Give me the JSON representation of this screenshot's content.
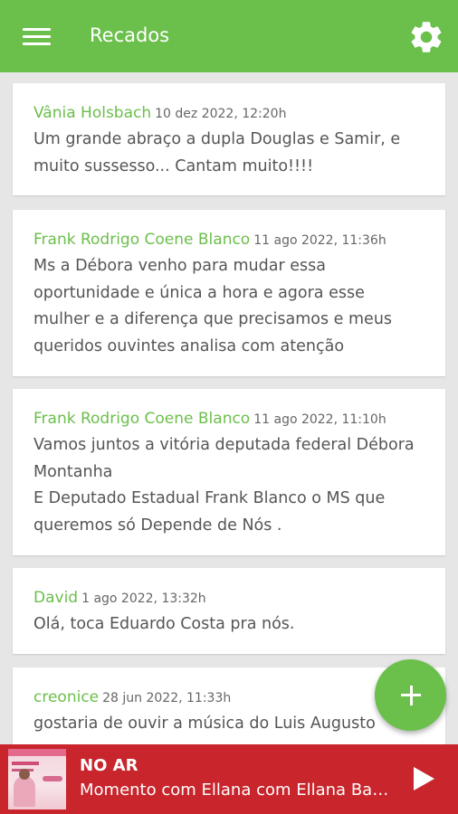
{
  "appbar": {
    "title": "Recados",
    "menu_icon": "hamburger-menu-icon",
    "settings_icon": "gear-icon",
    "color": "#6bbf4b"
  },
  "messages": [
    {
      "author": "Vânia Holsbach",
      "date": "10 dez 2022, 12:20h",
      "text": "Um grande abraço a dupla Douglas e Samir, e muito sussesso... Cantam muito!!!!"
    },
    {
      "author": "Frank Rodrigo Coene Blanco",
      "date": "11 ago 2022, 11:36h",
      "text": "Ms a Débora venho para mudar essa oportunidade e única a hora e agora esse mulher e a diferença que precisamos e meus queridos ouvintes analisa com atenção"
    },
    {
      "author": "Frank Rodrigo Coene Blanco",
      "date": "11 ago 2022, 11:10h",
      "text": "Vamos juntos a vitória deputada federal Débora Montanha\nE Deputado Estadual Frank Blanco o MS que queremos só Depende de Nós ."
    },
    {
      "author": "David",
      "date": "1 ago 2022, 13:32h",
      "text": "Olá, toca Eduardo Costa pra nós."
    },
    {
      "author": "creonice",
      "date": "28 jun 2022, 11:33h",
      "text": "gostaria de ouvir a música do Luis Augusto"
    }
  ],
  "fab": {
    "icon": "plus-icon"
  },
  "player": {
    "status": "NO AR",
    "now_playing": "Momento com Ellana com Ellana Barros",
    "play_icon": "play-icon",
    "color": "#c8252c"
  }
}
